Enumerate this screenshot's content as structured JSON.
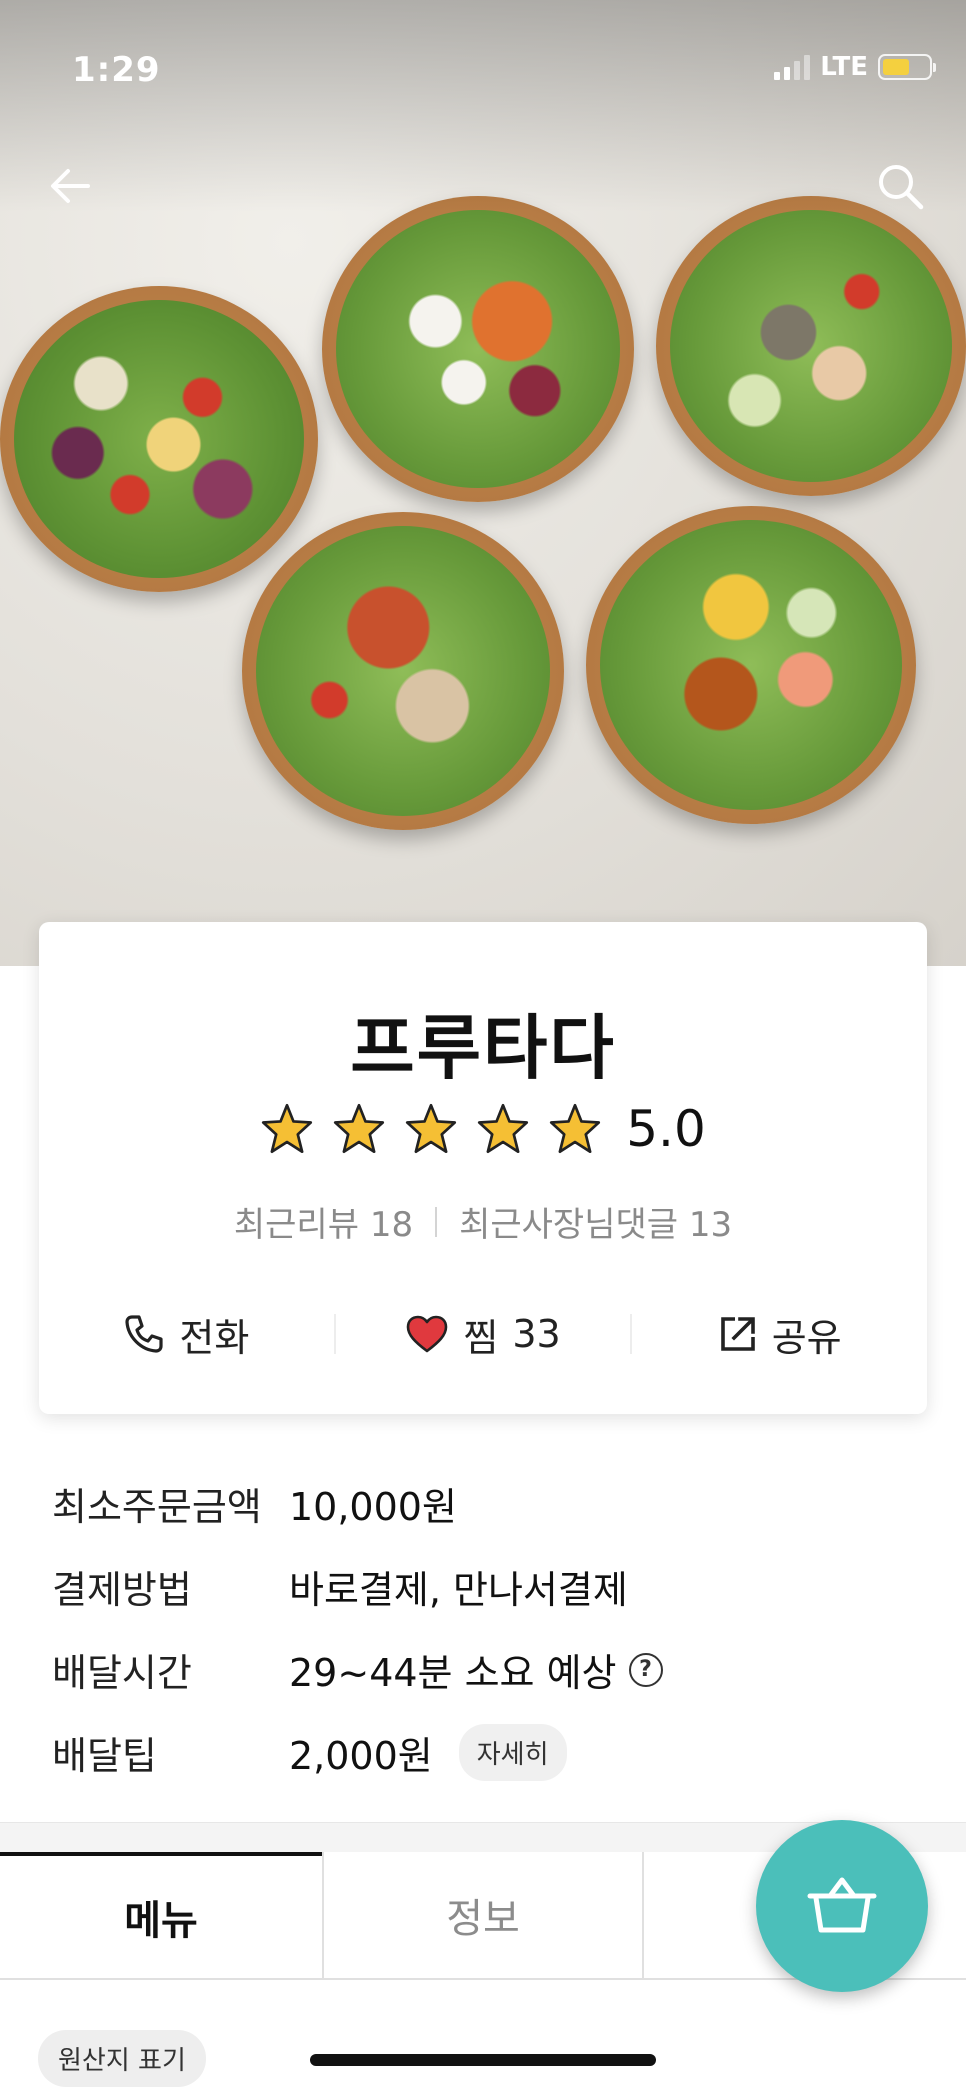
{
  "status_bar": {
    "time": "1:29",
    "network": "LTE",
    "battery_color": "#f4d03f"
  },
  "header": {
    "back_icon": "arrow-left-icon",
    "search_icon": "search-icon"
  },
  "store": {
    "name": "프루타다",
    "rating": "5.0",
    "stars": 5,
    "recent_reviews_label": "최근리뷰",
    "recent_reviews_count": "18",
    "owner_replies_label": "최근사장님댓글",
    "owner_replies_count": "13"
  },
  "actions": {
    "call_label": "전화",
    "like_label": "찜",
    "like_count": "33",
    "share_label": "공유"
  },
  "info": {
    "min_order_label": "최소주문금액",
    "min_order_value": "10,000원",
    "payment_label": "결제방법",
    "payment_value": "바로결제, 만나서결제",
    "delivery_time_label": "배달시간",
    "delivery_time_value": "29~44분 소요 예상",
    "tip_label": "배달팁",
    "tip_value": "2,000원",
    "tip_detail_label": "자세히"
  },
  "tabs": [
    {
      "label": "메뉴",
      "active": true
    },
    {
      "label": "정보",
      "active": false
    }
  ],
  "origin_label": "원산지 표기",
  "colors": {
    "accent": "#4bbfba",
    "star": "#f5bf34",
    "heart": "#e0393e"
  }
}
